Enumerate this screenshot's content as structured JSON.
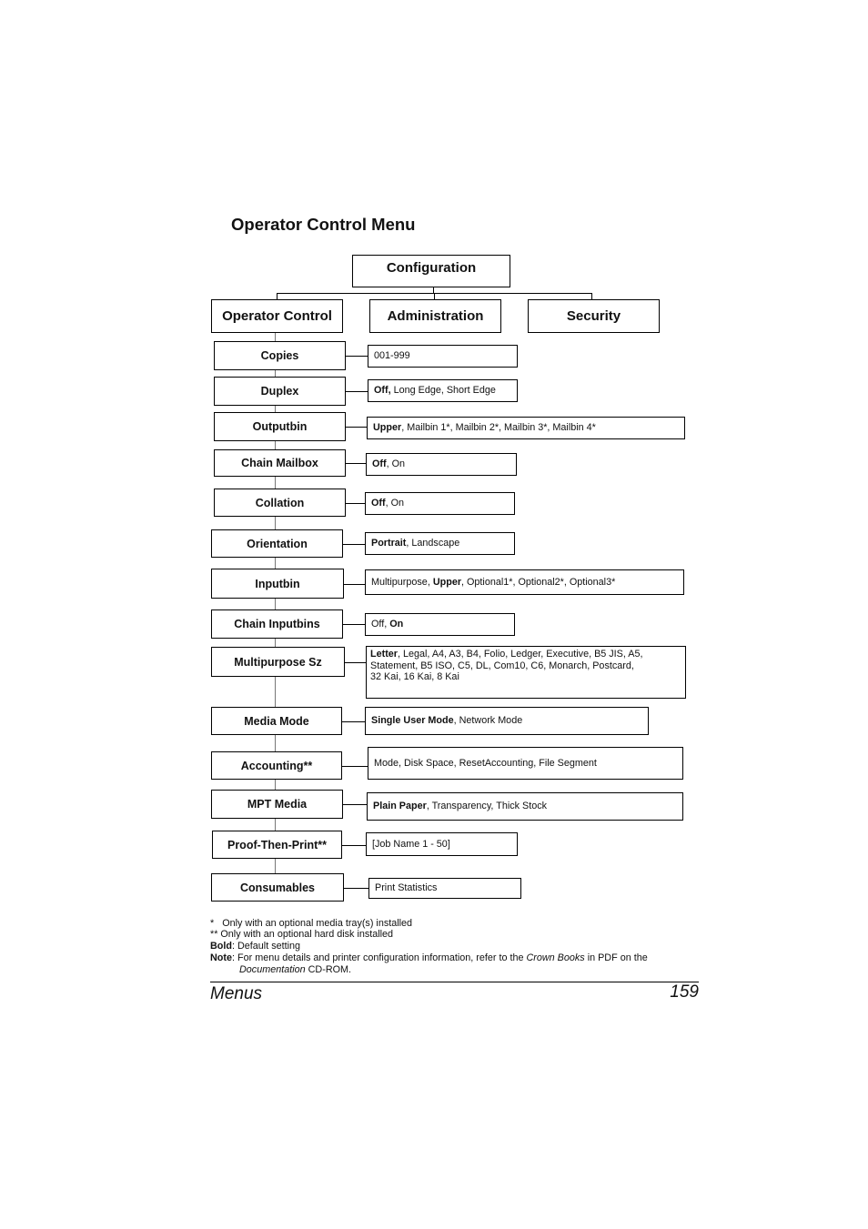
{
  "page": {
    "title": "Operator Control Menu",
    "footer_section": "Menus",
    "page_number": "159"
  },
  "tree": {
    "root": "Configuration",
    "children": [
      "Operator Control",
      "Administration",
      "Security"
    ]
  },
  "menu_items": [
    {
      "label": "Copies",
      "options": [
        {
          "text": "001-999",
          "bold": false
        }
      ]
    },
    {
      "label": "Duplex",
      "options": [
        {
          "text": "Off,",
          "bold": true
        },
        {
          "text": " Long Edge, Short Edge",
          "bold": false
        }
      ]
    },
    {
      "label": "Outputbin",
      "options": [
        {
          "text": "Upper",
          "bold": true
        },
        {
          "text": ", Mailbin 1*, Mailbin 2*, Mailbin 3*, Mailbin 4*",
          "bold": false
        }
      ]
    },
    {
      "label": "Chain Mailbox",
      "options": [
        {
          "text": "Off",
          "bold": true
        },
        {
          "text": ", On",
          "bold": false
        }
      ]
    },
    {
      "label": "Collation",
      "options": [
        {
          "text": "Off",
          "bold": true
        },
        {
          "text": ", On",
          "bold": false
        }
      ]
    },
    {
      "label": "Orientation",
      "options": [
        {
          "text": "Portrait",
          "bold": true
        },
        {
          "text": ", Landscape",
          "bold": false
        }
      ]
    },
    {
      "label": "Inputbin",
      "options": [
        {
          "text": "Multipurpose, ",
          "bold": false
        },
        {
          "text": "Upper",
          "bold": true
        },
        {
          "text": ", Optional1*, Optional2*, Optional3*",
          "bold": false
        }
      ]
    },
    {
      "label": "Chain Inputbins",
      "options": [
        {
          "text": "Off, ",
          "bold": false
        },
        {
          "text": "On",
          "bold": true
        }
      ]
    },
    {
      "label": "Multipurpose Sz",
      "options": [
        {
          "text": "Letter",
          "bold": true
        },
        {
          "text": ", Legal, A4, A3, B4, Folio, Ledger, Executive, B5 JIS, A5,\nStatement, B5 ISO, C5, DL, Com10, C6, Monarch, Postcard,\n32 Kai, 16 Kai, 8 Kai",
          "bold": false
        }
      ]
    },
    {
      "label": "Media Mode",
      "options": [
        {
          "text": "Single User Mode",
          "bold": true
        },
        {
          "text": ", Network Mode",
          "bold": false
        }
      ]
    },
    {
      "label": "Accounting**",
      "options": [
        {
          "text": "Mode, Disk Space, ResetAccounting, File Segment",
          "bold": false
        }
      ]
    },
    {
      "label": "MPT Media",
      "options": [
        {
          "text": "Plain Paper",
          "bold": true
        },
        {
          "text": ", Transparency, Thick Stock",
          "bold": false
        }
      ]
    },
    {
      "label": "Proof-Then-Print**",
      "options": [
        {
          "text": "[Job Name 1 - 50]",
          "bold": false
        }
      ]
    },
    {
      "label": "Consumables",
      "options": [
        {
          "text": "Print Statistics",
          "bold": false
        }
      ]
    }
  ],
  "notes": {
    "single_star_mark": "*",
    "single_star": "Only with an optional media tray(s) installed",
    "double_star_mark": "**",
    "double_star": "Only with an optional hard disk installed",
    "bold_label": "Bold",
    "bold_text": ": Default setting",
    "note_label": "Note",
    "note_text_1": ": For menu details and printer configuration information, refer to the ",
    "note_italic_1": "Crown Books",
    "note_text_2": " in PDF on the",
    "note_italic_2": "Documentation",
    "note_text_3": " CD-ROM."
  }
}
